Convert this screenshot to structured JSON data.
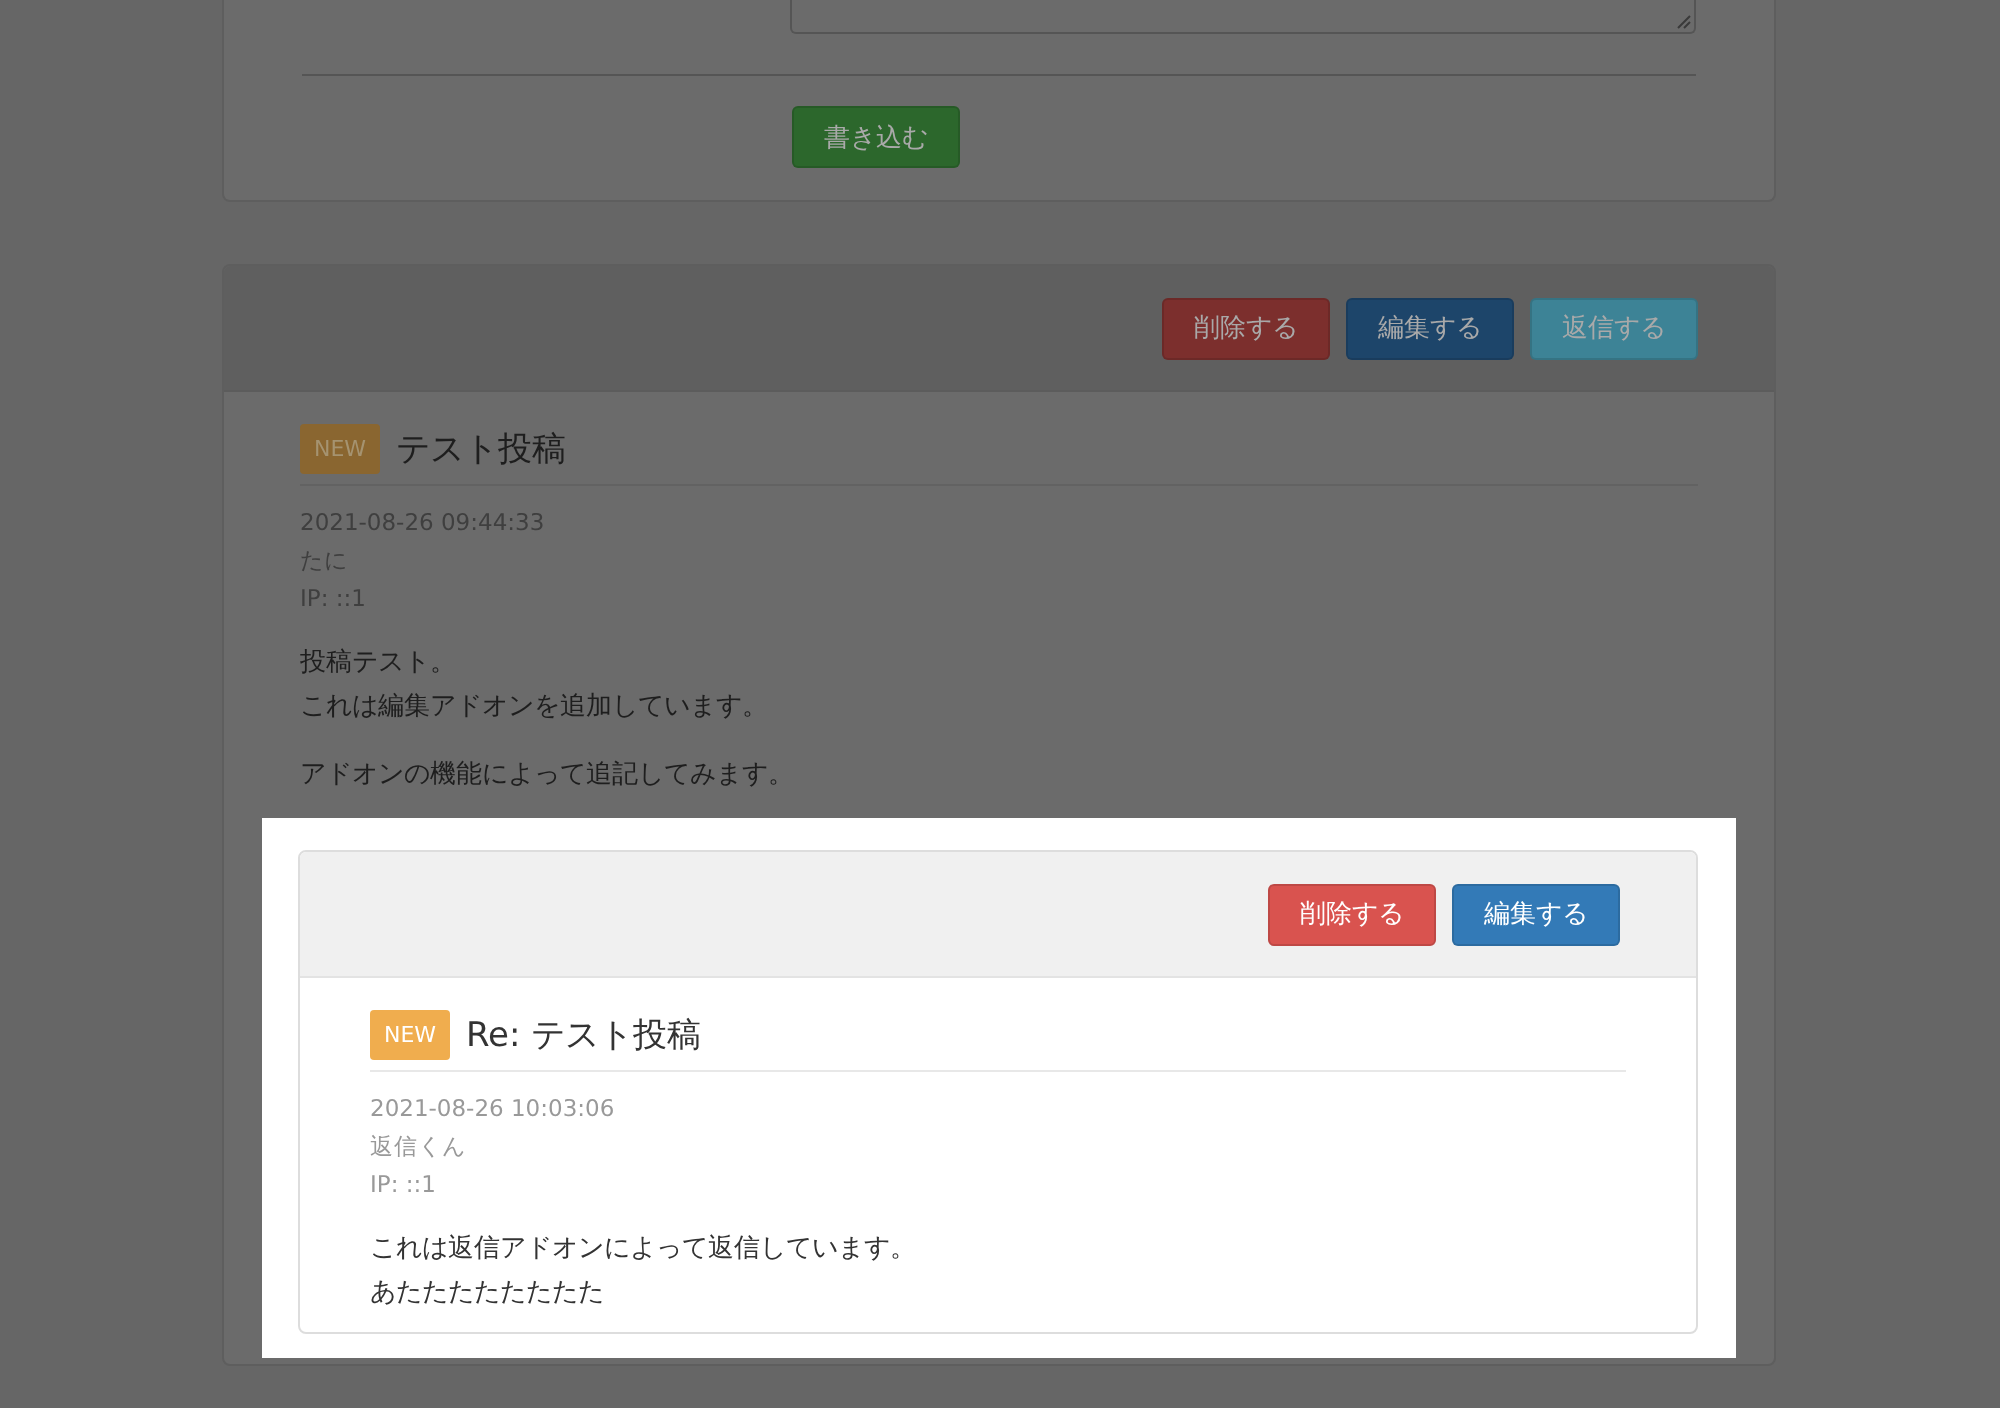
{
  "compose_form": {
    "highlighted": false,
    "submit_button": "書き込む"
  },
  "post": {
    "highlighted": false,
    "actions": [
      {
        "label": "削除する",
        "kind": "delete"
      },
      {
        "label": "編集する",
        "kind": "edit"
      },
      {
        "label": "返信する",
        "kind": "reply"
      }
    ],
    "badge": "NEW",
    "title": "テスト投稿",
    "date": "2021-08-26 09:44:33",
    "author": "たに",
    "ip": "IP: ::1",
    "paragraphs": [
      [
        "投稿テスト。",
        "これは編集アドオンを追加しています。"
      ],
      [
        "アドオンの機能によって追記してみます。"
      ]
    ],
    "reply": {
      "highlighted": true,
      "actions": [
        {
          "label": "削除する",
          "kind": "delete"
        },
        {
          "label": "編集する",
          "kind": "edit"
        }
      ],
      "badge": "NEW",
      "title": "Re: テスト投稿",
      "date": "2021-08-26 10:03:06",
      "author": "返信くん",
      "ip": "IP: ::1",
      "paragraphs": [
        [
          "これは返信アドオンによって返信しています。",
          "あたたたたたたたた"
        ]
      ]
    }
  }
}
